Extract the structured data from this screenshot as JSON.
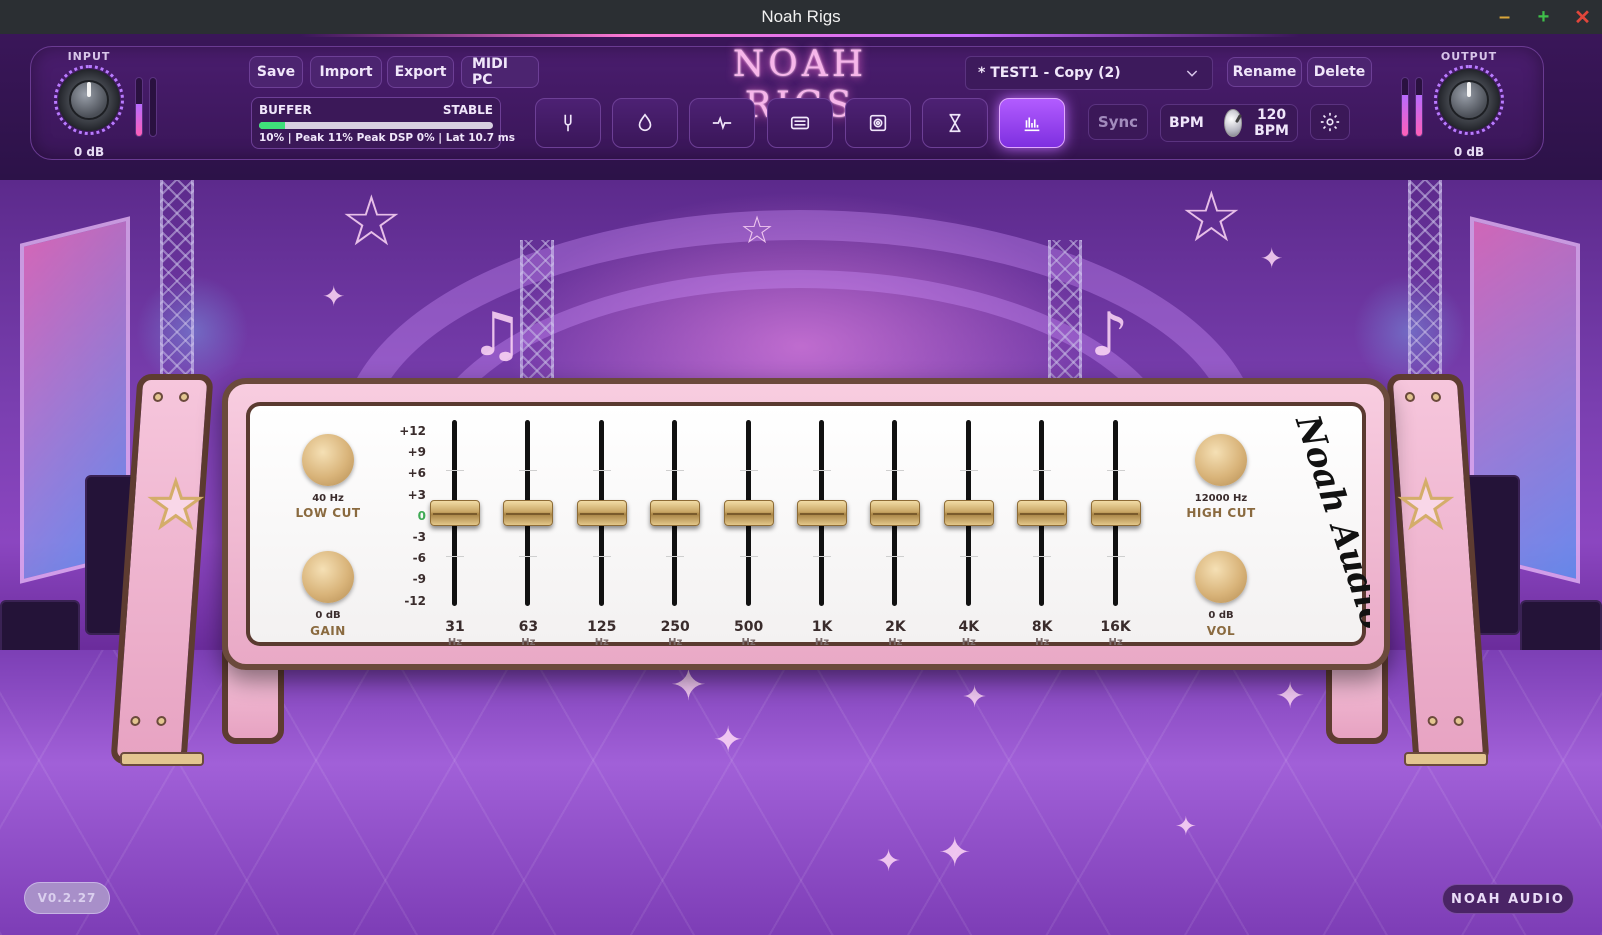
{
  "window": {
    "title": "Noah Rigs"
  },
  "header": {
    "logo": "NOAH RIGS",
    "input": {
      "label": "INPUT",
      "value": "0 dB",
      "meter_level": 0.55
    },
    "output": {
      "label": "OUTPUT",
      "value": "0 dB",
      "meter_level": 0.7
    },
    "buttons": {
      "save": "Save",
      "import": "Import",
      "export": "Export",
      "midi_pc": "MIDI PC",
      "rename": "Rename",
      "delete": "Delete"
    },
    "buffer": {
      "label": "BUFFER",
      "status": "STABLE",
      "fill": 0.11,
      "stats": "10% | Peak 11%    Peak DSP 0% | Lat 10.7 ms"
    },
    "tabs": [
      {
        "name": "tuner",
        "icon": "tuning-fork-icon"
      },
      {
        "name": "drop",
        "icon": "drop-icon"
      },
      {
        "name": "pulse",
        "icon": "pulse-icon"
      },
      {
        "name": "amp",
        "icon": "amp-icon"
      },
      {
        "name": "cabinet",
        "icon": "speaker-icon"
      },
      {
        "name": "timer",
        "icon": "hourglass-icon"
      },
      {
        "name": "equalizer",
        "icon": "equalizer-icon",
        "active": true
      }
    ],
    "preset": "* TEST1 - Copy (2)",
    "sync": "Sync",
    "bpm": {
      "label": "BPM",
      "value": "120",
      "unit": "BPM"
    }
  },
  "eq": {
    "low_cut": {
      "value": "40 Hz",
      "label": "LOW CUT"
    },
    "gain": {
      "value": "0 dB",
      "label": "GAIN"
    },
    "high_cut": {
      "value": "12000 Hz",
      "label": "HIGH CUT"
    },
    "vol": {
      "value": "0 dB",
      "label": "VOL"
    },
    "scale": [
      "+12",
      "+9",
      "+6",
      "+3",
      "0",
      "-3",
      "-6",
      "-9",
      "-12"
    ],
    "bands": [
      {
        "freq": "31",
        "unit": "Hz",
        "gain_db": 0
      },
      {
        "freq": "63",
        "unit": "Hz",
        "gain_db": 0
      },
      {
        "freq": "125",
        "unit": "Hz",
        "gain_db": 0
      },
      {
        "freq": "250",
        "unit": "Hz",
        "gain_db": 0
      },
      {
        "freq": "500",
        "unit": "Hz",
        "gain_db": 0
      },
      {
        "freq": "1K",
        "unit": "Hz",
        "gain_db": 0
      },
      {
        "freq": "2K",
        "unit": "Hz",
        "gain_db": 0
      },
      {
        "freq": "4K",
        "unit": "Hz",
        "gain_db": 0
      },
      {
        "freq": "8K",
        "unit": "Hz",
        "gain_db": 0
      },
      {
        "freq": "16K",
        "unit": "Hz",
        "gain_db": 0
      }
    ],
    "signature": "Noah Audio"
  },
  "footer": {
    "version": "V0.2.27",
    "brand": "NOAH AUDIO"
  }
}
